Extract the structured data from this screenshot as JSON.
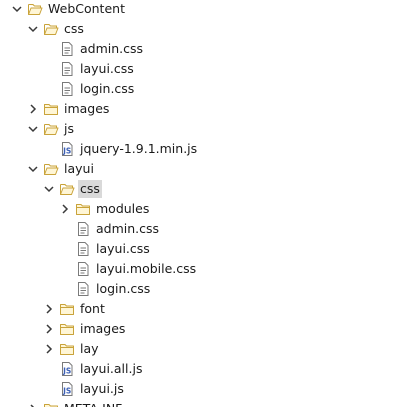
{
  "colors": {
    "folder_stroke": "#c9a33a",
    "folder_fill": "#fff6d6",
    "file_stroke": "#7a7a7a",
    "js_accent": "#3b5fb5",
    "twisty": "#3a3a3a",
    "selection": "#d9d9d9"
  },
  "tree": [
    {
      "label": "WebContent",
      "type": "folder",
      "expanded": true,
      "depth": 0
    },
    {
      "label": "css",
      "type": "folder",
      "expanded": true,
      "depth": 1
    },
    {
      "label": "admin.css",
      "type": "css-file",
      "depth": 2
    },
    {
      "label": "layui.css",
      "type": "css-file",
      "depth": 2
    },
    {
      "label": "login.css",
      "type": "css-file",
      "depth": 2
    },
    {
      "label": "images",
      "type": "folder",
      "expanded": false,
      "depth": 1
    },
    {
      "label": "js",
      "type": "folder",
      "expanded": true,
      "depth": 1
    },
    {
      "label": "jquery-1.9.1.min.js",
      "type": "js-file",
      "depth": 2
    },
    {
      "label": "layui",
      "type": "folder",
      "expanded": true,
      "depth": 1
    },
    {
      "label": "css",
      "type": "folder",
      "expanded": true,
      "depth": 2,
      "selected": true
    },
    {
      "label": "modules",
      "type": "folder",
      "expanded": false,
      "depth": 3
    },
    {
      "label": "admin.css",
      "type": "css-file",
      "depth": 3
    },
    {
      "label": "layui.css",
      "type": "css-file",
      "depth": 3
    },
    {
      "label": "layui.mobile.css",
      "type": "css-file",
      "depth": 3
    },
    {
      "label": "login.css",
      "type": "css-file",
      "depth": 3
    },
    {
      "label": "font",
      "type": "folder",
      "expanded": false,
      "depth": 2
    },
    {
      "label": "images",
      "type": "folder",
      "expanded": false,
      "depth": 2
    },
    {
      "label": "lay",
      "type": "folder",
      "expanded": false,
      "depth": 2
    },
    {
      "label": "layui.all.js",
      "type": "js-file",
      "depth": 2
    },
    {
      "label": "layui.js",
      "type": "js-file",
      "depth": 2
    },
    {
      "label": "META-INF",
      "type": "folder",
      "expanded": false,
      "depth": 1
    }
  ]
}
